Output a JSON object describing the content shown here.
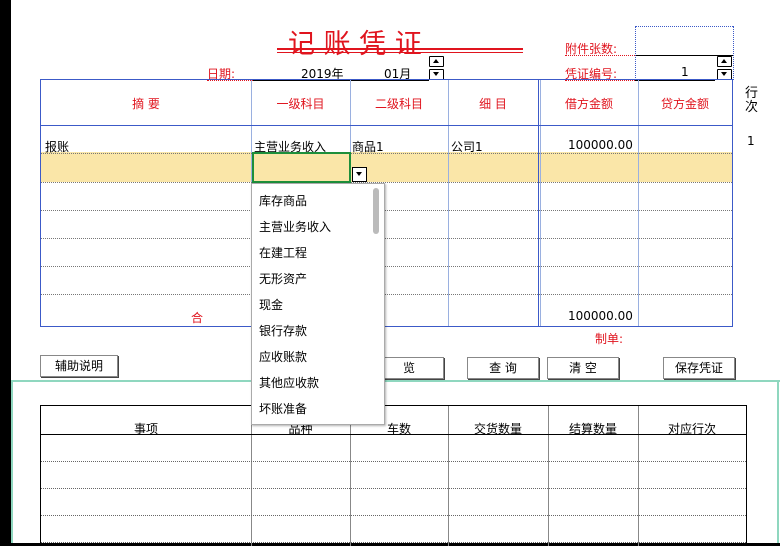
{
  "voucher": {
    "title": "记 账 凭 证",
    "attachments_label": "附件张数:",
    "date_label": "日期:",
    "year": "2019年",
    "month": "01月",
    "voucher_no_label": "凭证编号:",
    "voucher_no": "1",
    "row_label": "行次",
    "total_label": "合",
    "preparer_label": "制单:"
  },
  "table": {
    "headers": [
      "摘 要",
      "一级科目",
      "二级科目",
      "细 目",
      "借方金额",
      "贷方金额"
    ],
    "rows": [
      {
        "summary": "报账",
        "account1": "主营业务收入",
        "account2": "商品1",
        "detail": "公司1",
        "debit": "100000.00",
        "credit": "",
        "row_no": "1"
      }
    ],
    "total_debit": "100000.00"
  },
  "dropdown": {
    "options": [
      "库存商品",
      "主营业务收入",
      "在建工程",
      "无形资产",
      "现金",
      "银行存款",
      "应收账款",
      "其他应收款",
      "坏账准备"
    ]
  },
  "buttons": {
    "aux": "辅助说明",
    "browse": "览",
    "query": "查 询",
    "clear": "清 空",
    "save": "保存凭证"
  },
  "bottom_table": {
    "headers": [
      "事项",
      "品种",
      "车数",
      "交货数量",
      "结算数量",
      "对应行次"
    ]
  }
}
